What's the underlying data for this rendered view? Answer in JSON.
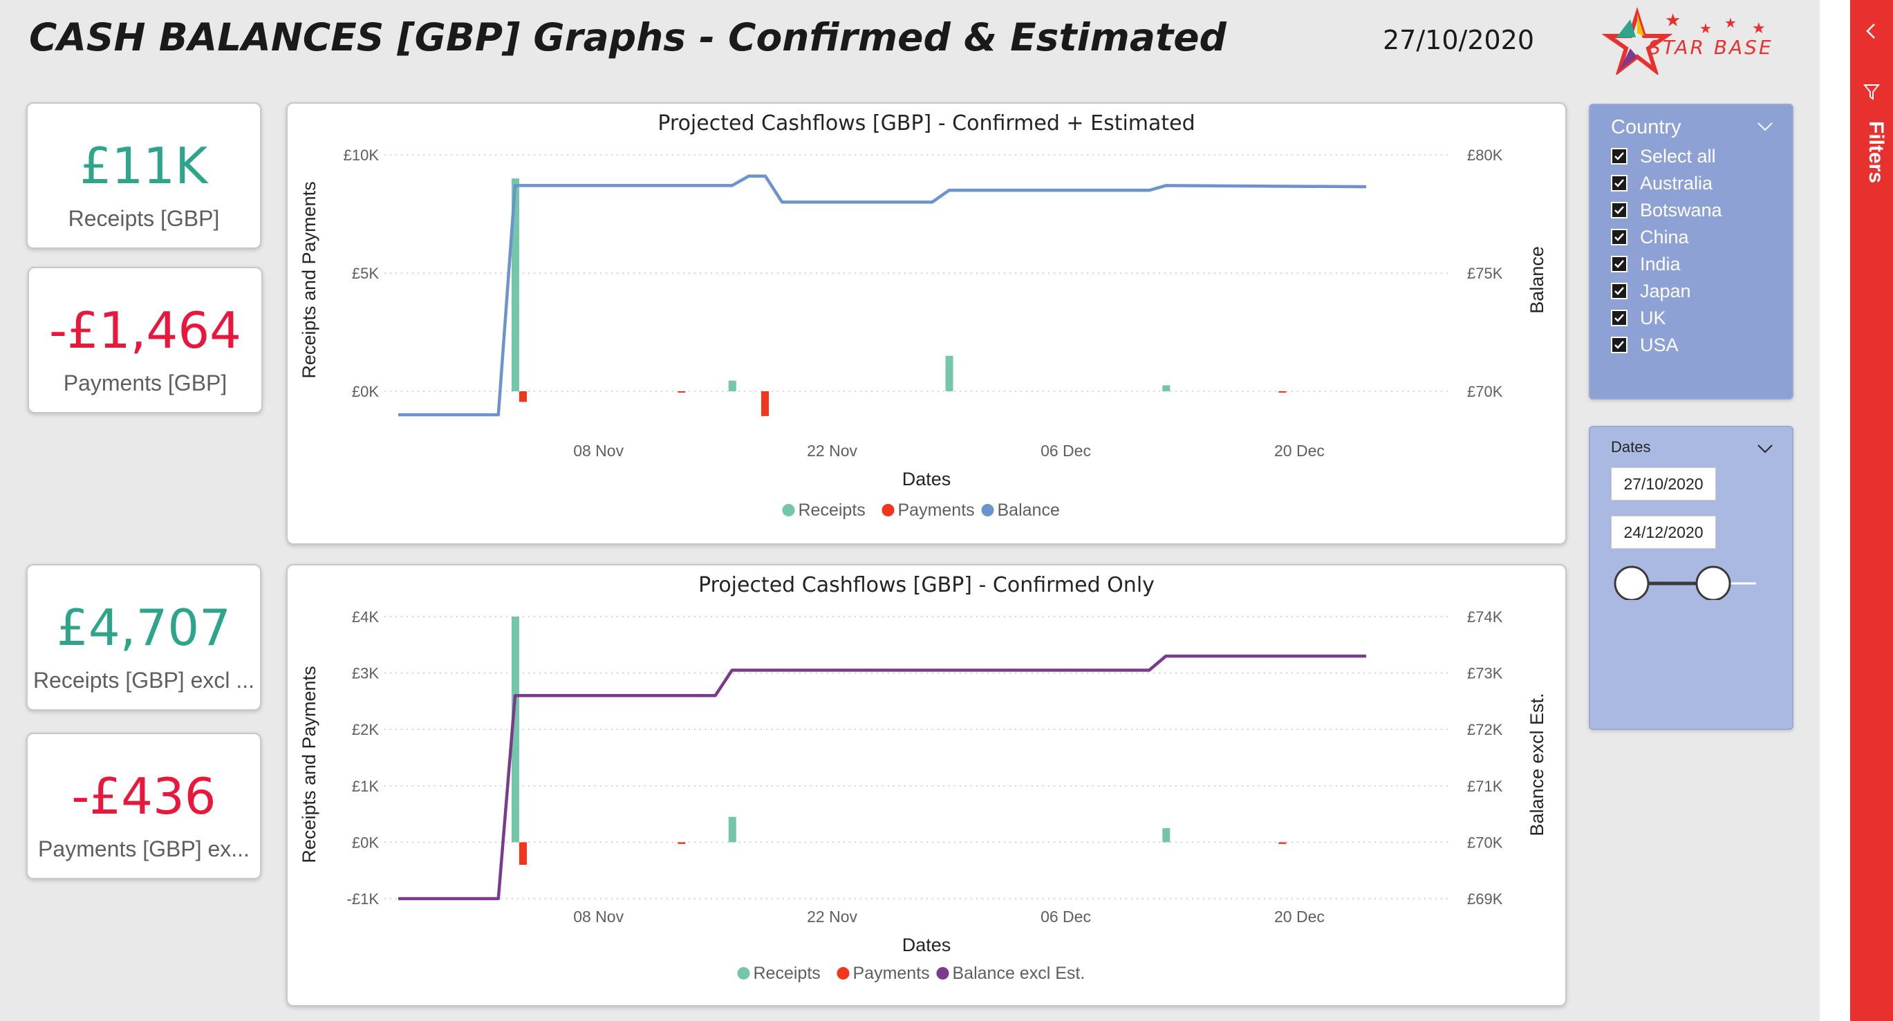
{
  "header": {
    "title": "CASH BALANCES [GBP] Graphs - Confirmed & Estimated",
    "date": "27/10/2020",
    "logo_text": "STAR BASE"
  },
  "kpis": [
    {
      "value": "£11K",
      "label": "Receipts [GBP]",
      "color": "#2ea58a"
    },
    {
      "value": "-£1,464",
      "label": "Payments [GBP]",
      "color": "#e8173b"
    },
    {
      "value": "£4,707",
      "label": "Receipts [GBP] excl ...",
      "color": "#2ea58a"
    },
    {
      "value": "-£436",
      "label": "Payments [GBP] ex...",
      "color": "#e8173b"
    }
  ],
  "colors": {
    "receipts": "#73c7a8",
    "payments": "#f2361d",
    "balance": "#6b93ce",
    "balance_excl": "#7b3a8e"
  },
  "chart_data": [
    {
      "type": "bar",
      "title": "Projected Cashflows [GBP] - Confirmed + Estimated",
      "xlabel": "Dates",
      "ylabel": "Receipts and Payments",
      "y2label": "Balance",
      "x_ticks": [
        "08 Nov",
        "22 Nov",
        "06 Dec",
        "20 Dec"
      ],
      "y_ticks": [
        "£10K",
        "£5K",
        "£0K"
      ],
      "y2_ticks": [
        "£80K",
        "£75K",
        "£70K"
      ],
      "ylim": [
        0,
        10000
      ],
      "y2lim": [
        70000,
        80000
      ],
      "grid": true,
      "legend": [
        "Receipts",
        "Payments",
        "Balance"
      ],
      "legend_position": "bottom",
      "series": [
        {
          "name": "Receipts",
          "points": [
            [
              "2020-11-03",
              9000
            ],
            [
              "2020-11-16",
              450
            ],
            [
              "2020-11-29",
              1500
            ],
            [
              "2020-12-12",
              250
            ]
          ]
        },
        {
          "name": "Payments",
          "points": [
            [
              "2020-11-03",
              -450
            ],
            [
              "2020-11-13",
              -50
            ],
            [
              "2020-11-18",
              -1050
            ],
            [
              "2020-12-19",
              -50
            ]
          ]
        },
        {
          "name": "Balance",
          "points": [
            [
              "2020-10-27",
              69000
            ],
            [
              "2020-11-02",
              69000
            ],
            [
              "2020-11-03",
              78700
            ],
            [
              "2020-11-15",
              78700
            ],
            [
              "2020-11-16",
              78700
            ],
            [
              "2020-11-17",
              79100
            ],
            [
              "2020-11-18",
              79100
            ],
            [
              "2020-11-19",
              78000
            ],
            [
              "2020-11-28",
              78000
            ],
            [
              "2020-11-29",
              78500
            ],
            [
              "2020-12-11",
              78500
            ],
            [
              "2020-12-12",
              78700
            ],
            [
              "2020-12-24",
              78650
            ]
          ]
        }
      ]
    },
    {
      "type": "bar",
      "title": "Projected Cashflows [GBP] - Confirmed Only",
      "xlabel": "Dates",
      "ylabel": "Receipts and Payments",
      "y2label": "Balance excl Est.",
      "x_ticks": [
        "08 Nov",
        "22 Nov",
        "06 Dec",
        "20 Dec"
      ],
      "y_ticks": [
        "£4K",
        "£3K",
        "£2K",
        "£1K",
        "£0K",
        "-£1K"
      ],
      "y2_ticks": [
        "£74K",
        "£73K",
        "£72K",
        "£71K",
        "£70K",
        "£69K"
      ],
      "ylim": [
        -1000,
        4000
      ],
      "y2lim": [
        69000,
        74000
      ],
      "grid": true,
      "legend": [
        "Receipts",
        "Payments",
        "Balance excl Est."
      ],
      "legend_position": "bottom",
      "series": [
        {
          "name": "Receipts",
          "points": [
            [
              "2020-11-03",
              4000
            ],
            [
              "2020-11-16",
              450
            ],
            [
              "2020-12-12",
              250
            ]
          ]
        },
        {
          "name": "Payments",
          "points": [
            [
              "2020-11-03",
              -400
            ],
            [
              "2020-11-13",
              -30
            ],
            [
              "2020-12-19",
              -30
            ]
          ]
        },
        {
          "name": "Balance excl Est.",
          "points": [
            [
              "2020-10-27",
              69000
            ],
            [
              "2020-11-02",
              69000
            ],
            [
              "2020-11-03",
              72600
            ],
            [
              "2020-11-13",
              72600
            ],
            [
              "2020-11-14",
              72600
            ],
            [
              "2020-11-15",
              72600
            ],
            [
              "2020-11-16",
              73050
            ],
            [
              "2020-12-11",
              73050
            ],
            [
              "2020-12-12",
              73300
            ],
            [
              "2020-12-24",
              73300
            ]
          ]
        }
      ]
    }
  ],
  "country_slicer": {
    "title": "Country",
    "options": [
      "Select all",
      "Australia",
      "Botswana",
      "China",
      "India",
      "Japan",
      "UK",
      "USA"
    ]
  },
  "dates_slicer": {
    "title": "Dates",
    "start": "27/10/2020",
    "end": "24/12/2020"
  },
  "filters_pane": {
    "label": "Filters"
  }
}
